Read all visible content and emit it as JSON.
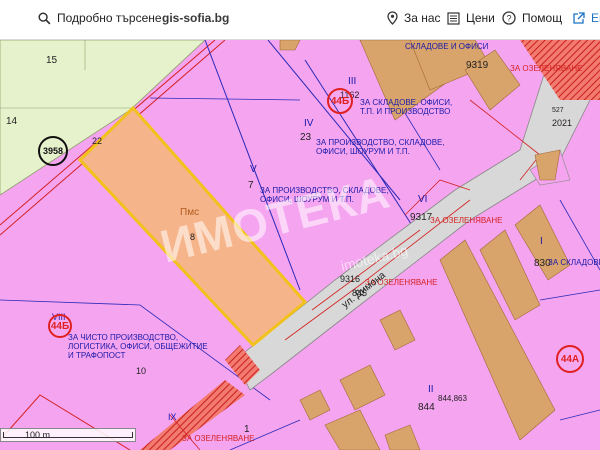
{
  "toolbar": {
    "search_label": "Подробно търсене",
    "brand": "gis-sofia.bg",
    "about_label": "За нас",
    "prices_label": "Цени",
    "help_label": "Помощ",
    "en_label": "En"
  },
  "map": {
    "parcels": {
      "p15": "15",
      "p14": "14",
      "p22": "22",
      "p23": "23",
      "p7": "7",
      "p8": "8",
      "p9319": "9319",
      "p9317": "9317",
      "p9316": "9316",
      "p845": "845",
      "p830": "830",
      "p844": "844",
      "p844_863": "844,863",
      "p10": "10",
      "p1": "1",
      "p2021": "2021",
      "p527": "527",
      "p1162": "1162"
    },
    "roman": {
      "r3": "III",
      "r4": "IV",
      "r5": "V",
      "r6": "VI",
      "r1": "I",
      "r2": "II",
      "r8": "VIII",
      "r9": "IX"
    },
    "labels": {
      "warehouses_offices": "СКЛАДОВЕ И ОФИСИ",
      "greening1": "ЗА ОЗЕЛЕНЯВАНЕ",
      "zone_3_line1": "ЗА СКЛАДОВЕ, ОФИСИ,",
      "zone_3_line2": "Т.П. И ПРОИЗВОДСТВО",
      "zone_4_line1": "ЗА ПРОИЗВОДСТВО, СКЛАДОВЕ,",
      "zone_4_line2": "ОФИСИ, ШОУРУМ И Т.П.",
      "zone_5_line1": "ЗА ПРОИЗВОДСТВО, СКЛАДОВЕ,",
      "zone_5_line2": "ОФИСИ, ШОУРУМ И Т.П.",
      "greening2": "ЗА ОЗЕЛЕНЯВАНЕ",
      "greening3": "ЗА ОЗЕЛЕНЯВАНЕ",
      "greening4": "ЗА ОЗЕЛЕНЯВАНЕ",
      "warehouses_right": "ЗА СКЛАДОВЕ",
      "zone_8_line1": "ЗА ЧИСТО ПРОИЗВОДСТВО,",
      "zone_8_line2": "ЛОГИСТИКА, ОФИСИ, ОБЩЕЖИТИЕ",
      "zone_8_line3": "И ТРАФОПОСТ",
      "pms": "Пмс"
    },
    "street": "ул. Димона",
    "badges": {
      "b44b_top": "44Б",
      "b44b_bottom": "44Б",
      "b44a": "44А",
      "b3958": "3958"
    },
    "watermark": "ИМОТЕКА",
    "watermark_sub": "imoteka.bg",
    "scale_label": "100 m"
  },
  "colors": {
    "zone_pink": "#f5a4f0",
    "green_area": "#e6f2cc",
    "highlight_fill": "#f6b48a",
    "highlight_border": "#f2c21b",
    "road_gray": "#d8d8d8",
    "building_orange": "#d9a46b",
    "red_hatch": "#e8382e",
    "boundary_blue": "#2a2ab8",
    "accent_link": "#1a73c8"
  }
}
